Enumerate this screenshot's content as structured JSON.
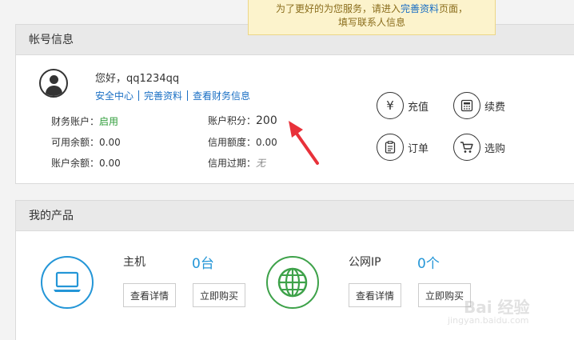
{
  "notice": {
    "line1_prefix": "为了更好的为您服务，请进入",
    "line1_link": "完善资料",
    "line1_suffix": "页面，",
    "line2": "填写联系人信息"
  },
  "account": {
    "title": "帐号信息",
    "greeting": "您好，qq1234qq",
    "links": [
      "安全中心",
      "完善资料",
      "查看财务信息"
    ],
    "rows": [
      {
        "label": "财务账户：",
        "value": "启用",
        "color": "#2e9c39"
      },
      {
        "label": "可用余额：",
        "value": "0.00"
      },
      {
        "label": "账户余额：",
        "value": "0.00"
      },
      {
        "label": "账户积分：",
        "value": "200"
      },
      {
        "label": "信用额度：",
        "value": "0.00"
      },
      {
        "label": "信用过期：",
        "value": "无"
      }
    ],
    "actions": [
      {
        "icon": "yen-icon",
        "label": "充值"
      },
      {
        "icon": "calculator-icon",
        "label": "续费"
      },
      {
        "icon": "order-icon",
        "label": "订单"
      },
      {
        "icon": "cart-icon",
        "label": "选购"
      }
    ]
  },
  "products": {
    "title": "我的产品",
    "items": [
      {
        "name": "主机",
        "count": "0台",
        "icon": "laptop-icon",
        "color": "#2496d7",
        "details_label": "查看详情",
        "buy_label": "立即购买"
      },
      {
        "name": "公网IP",
        "count": "0个",
        "icon": "globe-icon",
        "color": "#3ea24a",
        "details_label": "查看详情",
        "buy_label": "立即购买"
      }
    ]
  },
  "watermark": {
    "text": "Bai 经验",
    "url": "jingyan.baidu.com"
  },
  "colors": {
    "accent": "#1a6fc4",
    "annotation_arrow": "#e8313a"
  }
}
